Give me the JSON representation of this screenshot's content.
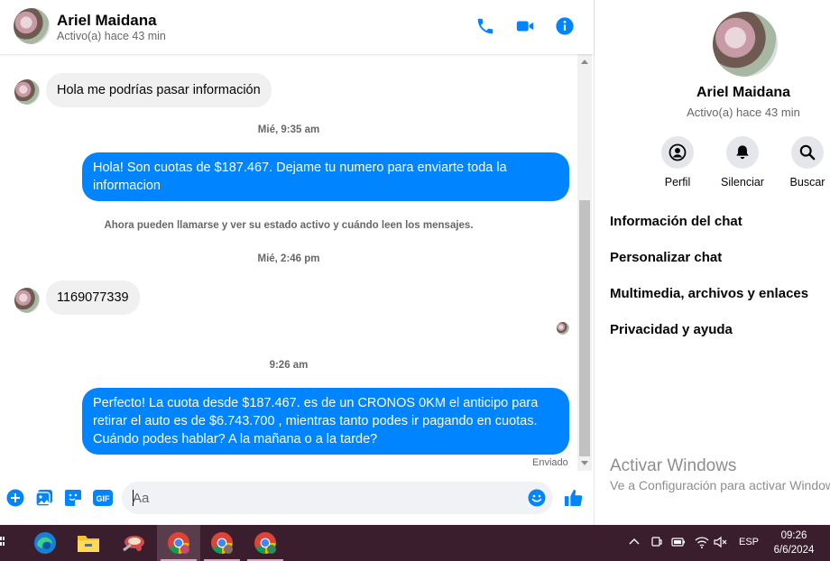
{
  "contact": {
    "name": "Ariel Maidana",
    "status": "Activo(a) hace 43 min"
  },
  "header_icons": [
    "phone-icon",
    "video-camera-icon",
    "info-icon"
  ],
  "messages": {
    "cut_text": ", ... p ...",
    "incoming_1": "Hola me podrías pasar información",
    "ts_1": "Mié, 9:35 am",
    "outgoing_1": "Hola! Son cuotas de $187.467. Dejame tu numero para enviarte toda la informacion",
    "system": "Ahora pueden llamarse y ver su estado activo y cuándo leen los mensajes.",
    "ts_2": "Mié, 2:46 pm",
    "incoming_2": "1169077339",
    "ts_3": "9:26 am",
    "outgoing_2": "Perfecto! La cuota desde $187.467. es de un CRONOS 0KM el anticipo para retirar el auto es de $6.743.700 , mientras tanto podes ir pagando en cuotas. Cuándo podes hablar? A la mañana o a la tarde?",
    "sent_label": "Enviado"
  },
  "composer": {
    "placeholder": "Aa",
    "icons": [
      "plus-icon",
      "image-icon",
      "sticker-icon",
      "gif-icon",
      "emoji-icon",
      "like-icon"
    ],
    "gif_text": "GIF"
  },
  "info_panel": {
    "name": "Ariel Maidana",
    "status": "Activo(a) hace 43 min",
    "actions": [
      {
        "label": "Perfil",
        "icon": "profile-icon"
      },
      {
        "label": "Silenciar",
        "icon": "bell-icon"
      },
      {
        "label": "Buscar",
        "icon": "search-icon"
      }
    ],
    "menu": [
      "Información del chat",
      "Personalizar chat",
      "Multimedia, archivos y enlaces",
      "Privacidad y ayuda"
    ],
    "watermark_title": "Activar Windows",
    "watermark_sub": "Ve a Configuración para activar Windows."
  },
  "taskbar": {
    "apps": [
      "edge-icon",
      "file-explorer-icon",
      "app-icon",
      "chrome-icon",
      "chrome-profile-icon",
      "chrome-profile-t-icon"
    ],
    "lang": "ESP",
    "time": "09:26",
    "date": "6/6/2024"
  },
  "colors": {
    "accent": "#0084ff",
    "bubble_in": "#f0f0f0",
    "taskbar": "#3a1e2d"
  }
}
